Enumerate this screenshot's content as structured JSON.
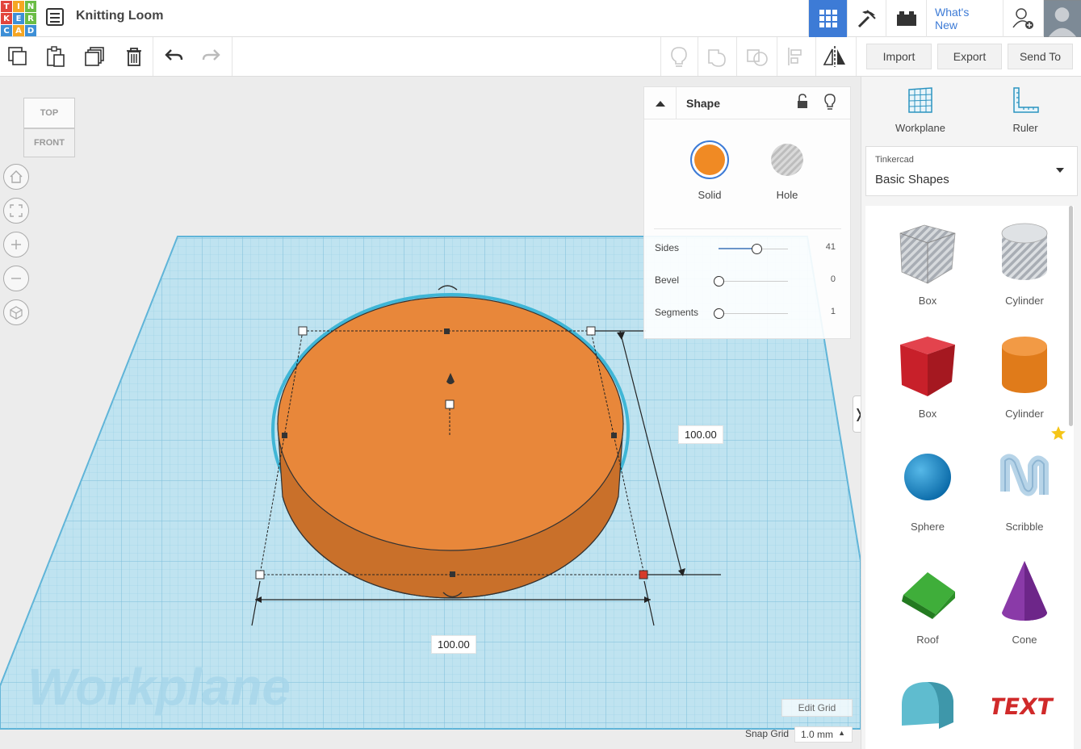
{
  "app": {
    "logo_letters": [
      "T",
      "I",
      "N",
      "K",
      "E",
      "R",
      "C",
      "A",
      "D"
    ],
    "logo_colors": [
      "#e2453c",
      "#f5a623",
      "#6bbd45",
      "#e2453c",
      "#3d8fd6",
      "#6bbd45",
      "#3d8fd6",
      "#f5a623",
      "#3d8fd6"
    ],
    "title": "Knitting Loom"
  },
  "topbar": {
    "whats_new": "What's New",
    "accent": "#3d7bd6"
  },
  "toolbar": {
    "import": "Import",
    "export": "Export",
    "send_to": "Send To"
  },
  "viewcube": {
    "top": "TOP",
    "front": "FRONT"
  },
  "canvas": {
    "workplane_watermark": "Workplane",
    "dim_depth": "100.00",
    "dim_width": "100.00",
    "edit_grid": "Edit Grid",
    "snap_grid_label": "Snap Grid",
    "snap_grid_value": "1.0 mm",
    "shape_color": "#e8873a"
  },
  "inspector": {
    "title": "Shape",
    "solid_label": "Solid",
    "hole_label": "Hole",
    "solid_color": "#f08a24",
    "params": [
      {
        "label": "Sides",
        "value": "41",
        "fraction": 0.55
      },
      {
        "label": "Bevel",
        "value": "0",
        "fraction": 0.0
      },
      {
        "label": "Segments",
        "value": "1",
        "fraction": 0.0
      }
    ]
  },
  "right_panel": {
    "workplane": "Workplane",
    "ruler": "Ruler",
    "library_source": "Tinkercad",
    "library_name": "Basic Shapes",
    "shapes": [
      {
        "label": "Box",
        "icon": "box-hole-icon"
      },
      {
        "label": "Cylinder",
        "icon": "cylinder-hole-icon"
      },
      {
        "label": "Box",
        "icon": "box-icon"
      },
      {
        "label": "Cylinder",
        "icon": "cylinder-icon"
      },
      {
        "label": "Sphere",
        "icon": "sphere-icon"
      },
      {
        "label": "Scribble",
        "icon": "scribble-icon"
      },
      {
        "label": "Roof",
        "icon": "roof-icon"
      },
      {
        "label": "Cone",
        "icon": "cone-icon"
      },
      {
        "label": "",
        "icon": "half-cylinder-icon"
      },
      {
        "label": "",
        "icon": "text-icon"
      }
    ]
  }
}
